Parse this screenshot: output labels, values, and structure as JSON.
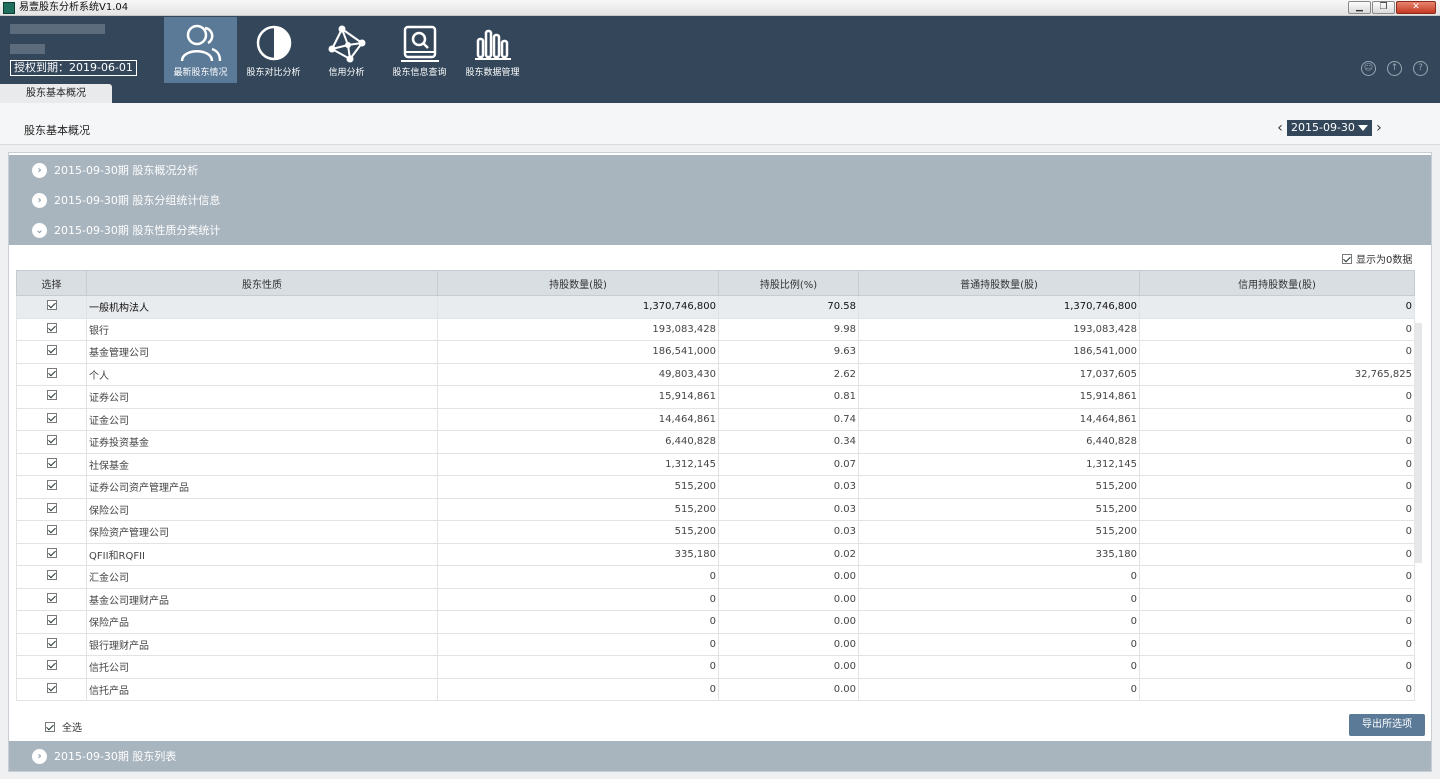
{
  "window": {
    "title": "易壹股东分析系统V1.04",
    "buttons": [
      "▁",
      "❐",
      "✕"
    ]
  },
  "header": {
    "license": "授权到期：2019-06-01",
    "nav": [
      {
        "label": "最新股东情况",
        "icon": "users-icon",
        "active": true
      },
      {
        "label": "股东对比分析",
        "icon": "half-circle-icon",
        "active": false
      },
      {
        "label": "信用分析",
        "icon": "network-icon",
        "active": false
      },
      {
        "label": "股东信息查询",
        "icon": "search-disk-icon",
        "active": false
      },
      {
        "label": "股东数据管理",
        "icon": "bar-chart-icon",
        "active": false
      }
    ],
    "tab": "股东基本概况",
    "right_icons": [
      "user-icon",
      "upload-icon",
      "help-icon"
    ]
  },
  "page": {
    "title": "股东基本概况",
    "date": "2015-09-30"
  },
  "sections": {
    "s1": "2015-09-30期 股东概况分析",
    "s2": "2015-09-30期 股东分组统计信息",
    "s3": "2015-09-30期 股东性质分类统计",
    "s4": "2015-09-30期 股东列表"
  },
  "show_zero_label": "显示为0数据",
  "table": {
    "headers": [
      "选择",
      "股东性质",
      "持股数量(股)",
      "持股比例(%)",
      "普通持股数量(股)",
      "信用持股数量(股)"
    ],
    "rows": [
      [
        "一般机构法人",
        "1,370,746,800",
        "70.58",
        "1,370,746,800",
        "0"
      ],
      [
        "银行",
        "193,083,428",
        "9.98",
        "193,083,428",
        "0"
      ],
      [
        "基金管理公司",
        "186,541,000",
        "9.63",
        "186,541,000",
        "0"
      ],
      [
        "个人",
        "49,803,430",
        "2.62",
        "17,037,605",
        "32,765,825"
      ],
      [
        "证券公司",
        "15,914,861",
        "0.81",
        "15,914,861",
        "0"
      ],
      [
        "证金公司",
        "14,464,861",
        "0.74",
        "14,464,861",
        "0"
      ],
      [
        "证券投资基金",
        "6,440,828",
        "0.34",
        "6,440,828",
        "0"
      ],
      [
        "社保基金",
        "1,312,145",
        "0.07",
        "1,312,145",
        "0"
      ],
      [
        "证券公司资产管理产品",
        "515,200",
        "0.03",
        "515,200",
        "0"
      ],
      [
        "保险公司",
        "515,200",
        "0.03",
        "515,200",
        "0"
      ],
      [
        "保险资产管理公司",
        "515,200",
        "0.03",
        "515,200",
        "0"
      ],
      [
        "QFII和RQFII",
        "335,180",
        "0.02",
        "335,180",
        "0"
      ],
      [
        "汇金公司",
        "0",
        "0.00",
        "0",
        "0"
      ],
      [
        "基金公司理财产品",
        "0",
        "0.00",
        "0",
        "0"
      ],
      [
        "保险产品",
        "0",
        "0.00",
        "0",
        "0"
      ],
      [
        "银行理财产品",
        "0",
        "0.00",
        "0",
        "0"
      ],
      [
        "信托公司",
        "0",
        "0.00",
        "0",
        "0"
      ],
      [
        "信托产品",
        "0",
        "0.00",
        "0",
        "0"
      ]
    ]
  },
  "select_all_label": "全选",
  "export_label": "导出所选项"
}
